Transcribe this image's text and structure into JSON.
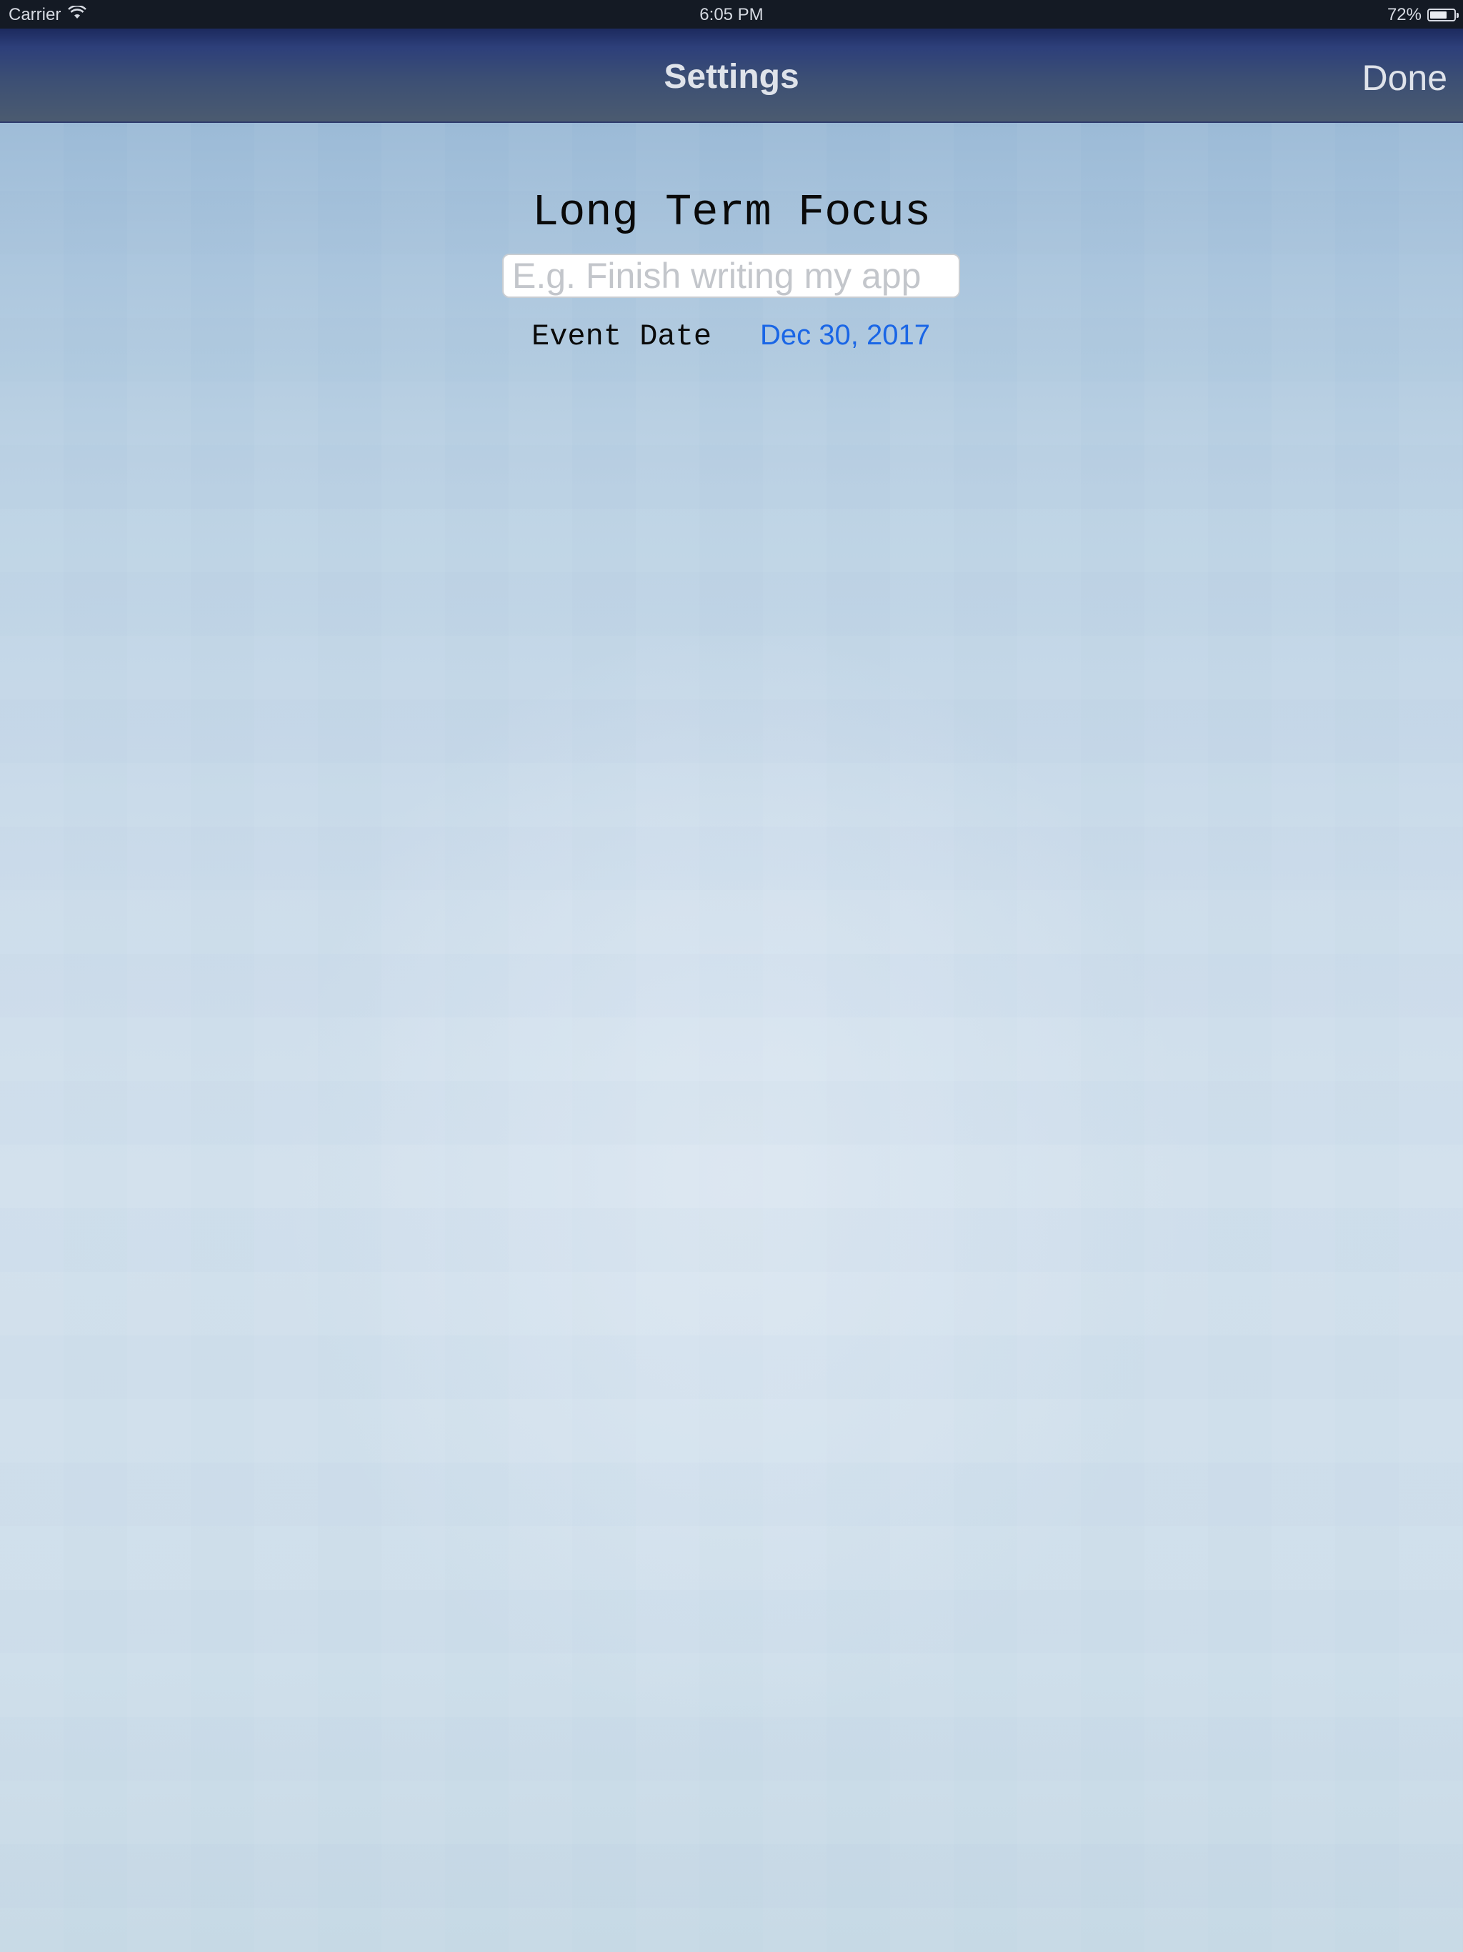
{
  "status_bar": {
    "carrier": "Carrier",
    "time": "6:05 PM",
    "battery_percent_text": "72%",
    "battery_level": 0.72,
    "wifi_icon": "wifi-icon",
    "battery_icon": "battery-icon"
  },
  "nav": {
    "title": "Settings",
    "done_label": "Done"
  },
  "main": {
    "focus_title": "Long Term Focus",
    "focus_input": {
      "placeholder": "E.g. Finish writing my app",
      "value": ""
    },
    "event_label": "Event Date",
    "event_date": "Dec 30, 2017"
  },
  "colors": {
    "accent": "#1a66e6",
    "nav_text": "#dfe3ea"
  }
}
